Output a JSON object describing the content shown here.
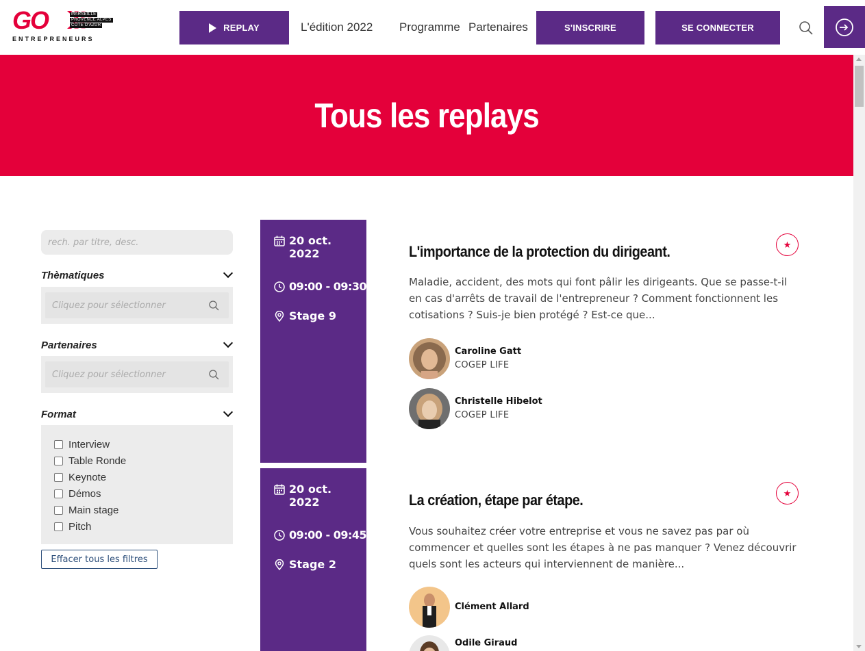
{
  "header": {
    "logo_text": "GO",
    "logo_sub": [
      "MARSEILLE",
      "PROVENCE ALPES",
      "CÔTE D'AZUR"
    ],
    "logo_entrepreneurs": "ENTREPRENEURS",
    "replay_label": "REPLAY",
    "nav": {
      "edition": "L'édition 2022",
      "programme": "Programme",
      "partenaires": "Partenaires"
    },
    "inscrire_label": "S'INSCRIRE",
    "connect_label": "SE CONNECTER",
    "colors": {
      "purple": "#5b2a86",
      "red": "#e4003a"
    }
  },
  "hero": {
    "title": "Tous les replays"
  },
  "filters": {
    "search_placeholder": "rech. par titre, desc.",
    "thematiques": {
      "label": "Thèmatiques",
      "placeholder": "Cliquez pour sélectionner"
    },
    "partenaires": {
      "label": "Partenaires",
      "placeholder": "Cliquez pour sélectionner"
    },
    "format": {
      "label": "Format",
      "options": [
        "Interview",
        "Table Ronde",
        "Keynote",
        "Démos",
        "Main stage",
        "Pitch"
      ]
    },
    "clear_label": "Effacer tous les filtres"
  },
  "sessions": [
    {
      "date": "20 oct. 2022",
      "time": "09:00 - 09:30",
      "stage": "Stage 9",
      "title": "L'importance de la protection du dirigeant.",
      "description": "Maladie, accident, des mots qui font pâlir les dirigeants. Que se passe-t-il en cas d'arrêts de travail de l'entrepreneur ? Comment fonctionnent les cotisations ? Suis-je bien protégé ? Est-ce que...",
      "speakers": [
        {
          "name": "Caroline Gatt",
          "company": "COGEP LIFE"
        },
        {
          "name": "Christelle Hibelot",
          "company": "COGEP LIFE"
        }
      ]
    },
    {
      "date": "20 oct. 2022",
      "time": "09:00 - 09:45",
      "stage": "Stage 2",
      "title": "La création, étape par étape.",
      "description": "Vous souhaitez créer votre entreprise et vous ne savez pas par où commencer et quelles sont les étapes à ne pas manquer ? Venez découvrir quels sont les acteurs qui interviennent de manière...",
      "speakers": [
        {
          "name": "Clément Allard",
          "company": ""
        },
        {
          "name": "Odile Giraud",
          "company": ""
        }
      ]
    }
  ]
}
